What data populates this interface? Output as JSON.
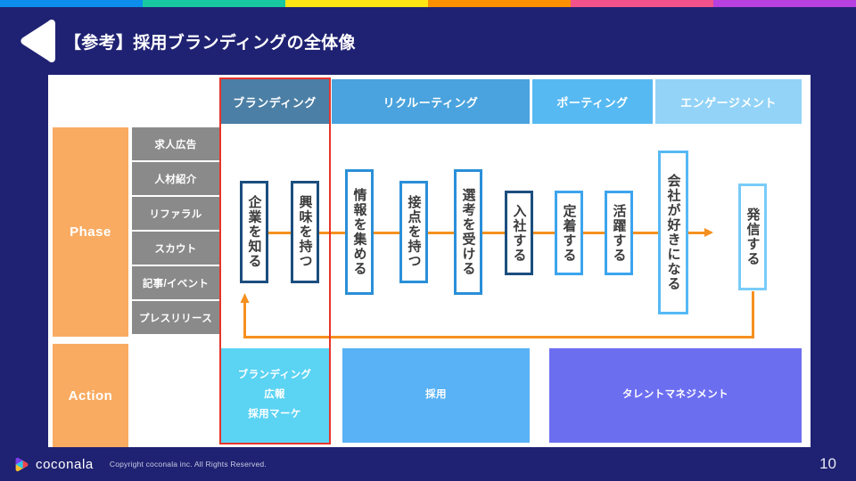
{
  "top_stripe": {
    "colors": [
      "#0d8eec",
      "#17c8a0",
      "#ffe513",
      "#fa9000",
      "#f1528b",
      "#b640e0"
    ]
  },
  "header": {
    "title": "【参考】採用ブランディングの全体像",
    "play_icon": "left-triangle-icon"
  },
  "board": {
    "columns": [
      {
        "label": "ブランディング",
        "color": "#4c7fa5"
      },
      {
        "label": "リクルーティング",
        "color": "#4aa3de"
      },
      {
        "label": "ポーティング",
        "color": "#57b9f2"
      },
      {
        "label": "エンゲージメント",
        "color": "#93d3f7"
      }
    ],
    "row_labels": [
      {
        "label": "Phase",
        "color": "#f9ab62"
      },
      {
        "label": "Action",
        "color": "#f9ab62"
      }
    ],
    "channels": [
      "求人広告",
      "人材紹介",
      "リファラル",
      "スカウト",
      "記事/イベント",
      "プレスリリース"
    ],
    "phase_steps": [
      {
        "label": "企業を知る",
        "border": "#1b4e7e"
      },
      {
        "label": "興味を持つ",
        "border": "#1b4e7e"
      },
      {
        "label": "情報を集める",
        "border": "#2a8fd8"
      },
      {
        "label": "接点を持つ",
        "border": "#2a8fd8"
      },
      {
        "label": "選考を受ける",
        "border": "#2a8fd8"
      },
      {
        "label": "入社する",
        "border": "#1b4e7e"
      },
      {
        "label": "定着する",
        "border": "#3ba4ee"
      },
      {
        "label": "活躍する",
        "border": "#3ba4ee"
      },
      {
        "label": "会社が好きになる",
        "border": "#56b9f5"
      },
      {
        "label": "発信する",
        "border": "#78ccf9"
      }
    ],
    "actions": [
      {
        "labels": [
          "ブランディング",
          "広報",
          "採用マーケ"
        ],
        "color": "#5bd3f3"
      },
      {
        "labels": [
          "採用"
        ],
        "color": "#59b2f5"
      },
      {
        "labels": [
          "タレントマネジメント"
        ],
        "color": "#6c6ef0"
      }
    ],
    "highlight_color": "#e8342a",
    "connector_color": "#f5901f"
  },
  "footer": {
    "brand": "coconala",
    "copyright": "Copyright coconala inc. All Rights Reserved.",
    "page_number": "10"
  }
}
